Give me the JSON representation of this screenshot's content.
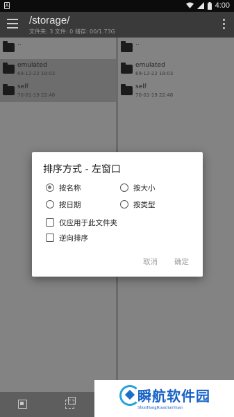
{
  "status_bar": {
    "time": "4:00",
    "left_glyph": "A",
    "icons": [
      "wifi-icon",
      "cell-signal-icon",
      "battery-icon"
    ]
  },
  "app_bar": {
    "title": "/storage/",
    "subtitle": "文件夹: 3  文件: 0  储存: 00/1.73G"
  },
  "left_pane": {
    "items": [
      {
        "name": "..",
        "date": ""
      },
      {
        "name": "emulated",
        "date": "69-12-22 18:03"
      },
      {
        "name": "self",
        "date": "70-01-19 22:48"
      }
    ]
  },
  "right_pane": {
    "items": [
      {
        "name": "..",
        "date": ""
      },
      {
        "name": "emulated",
        "date": "69-12-22 18:03"
      },
      {
        "name": "self",
        "date": "70-01-19 22:48"
      }
    ]
  },
  "dialog": {
    "title": "排序方式 - 左窗口",
    "options": {
      "by_name": "按名称",
      "by_size": "按大小",
      "by_date": "按日期",
      "by_type": "按类型"
    },
    "selected_option": "by_name",
    "checkboxes": {
      "current_folder_only": "仅应用于此文件夹",
      "reverse": "逆向排序"
    },
    "cancel_label": "取消",
    "ok_label": "确定"
  },
  "watermark": {
    "name": "瞬航软件园",
    "sub": "ShunHangRuanJianYuan"
  },
  "colors": {
    "accent": "#1762c6",
    "dialog_bg": "#ffffff",
    "scrim": "#7d7d7d"
  }
}
